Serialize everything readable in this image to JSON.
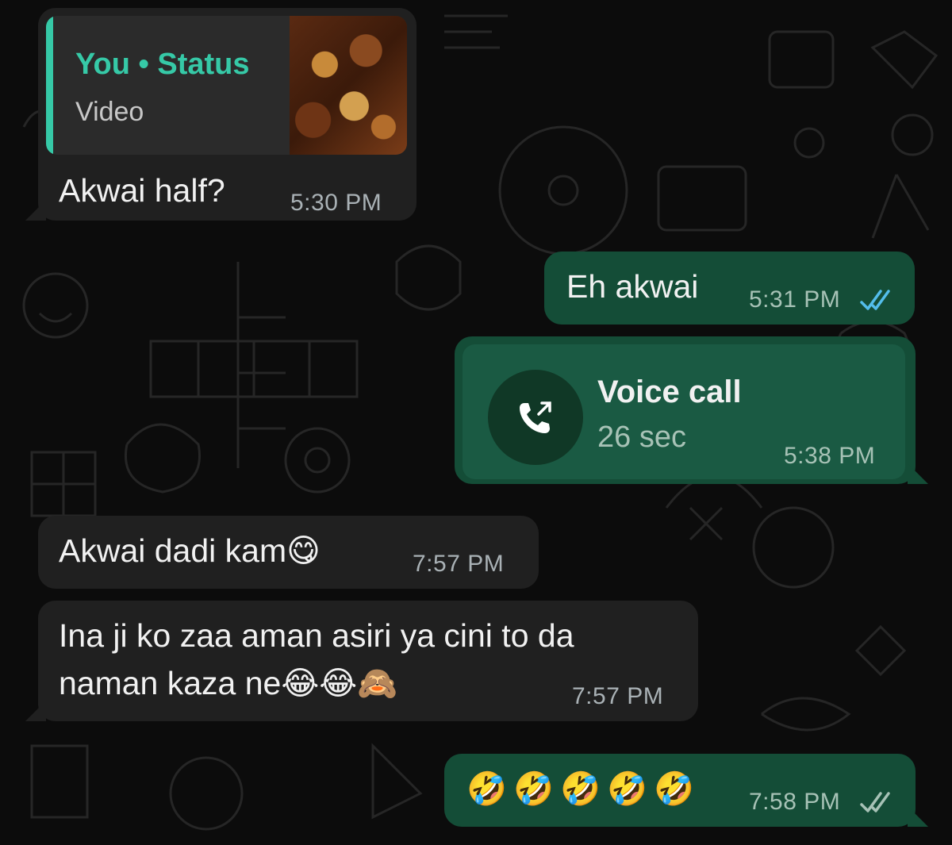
{
  "messages": [
    {
      "id": "m1",
      "direction": "incoming",
      "quote": {
        "title": "You • Status",
        "subtitle": "Video",
        "thumbnail": "food-video-thumbnail"
      },
      "text": "Akwai half?",
      "time": "5:30 PM"
    },
    {
      "id": "m2",
      "direction": "outgoing",
      "text": "Eh akwai",
      "time": "5:31 PM",
      "status": "read"
    },
    {
      "id": "m3",
      "direction": "outgoing",
      "call": {
        "title": "Voice call",
        "duration": "26 sec",
        "icon": "outgoing-call-icon"
      },
      "time": "5:38 PM"
    },
    {
      "id": "m4",
      "direction": "incoming",
      "text": "Akwai dadi kam",
      "emoji": "😋",
      "time": "7:57 PM"
    },
    {
      "id": "m5",
      "direction": "incoming",
      "line1": "Ina ji ko zaa aman asiri ya cini to da",
      "line2": "naman kaza ne",
      "emoji": "😂😂🙈",
      "time": "7:57 PM"
    },
    {
      "id": "m6",
      "direction": "outgoing",
      "emoji": "🤣🤣🤣🤣🤣",
      "time": "7:58 PM",
      "status": "delivered"
    }
  ],
  "colors": {
    "incoming_bubble": "#202020",
    "outgoing_bubble": "#144d37",
    "accent": "#36c9a7",
    "read_tick": "#53bdeb",
    "delivered_tick": "#a7c2b6"
  }
}
